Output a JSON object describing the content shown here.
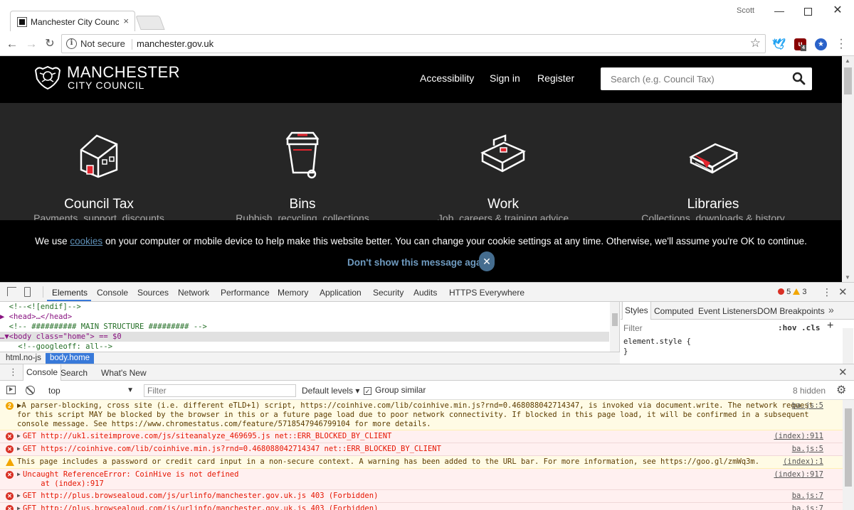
{
  "browser": {
    "tab_title": "Manchester City Council",
    "tab_close": "×",
    "user_name": "Scott",
    "window_buttons": {
      "minimize": "—",
      "maximize": "",
      "close": "✕"
    },
    "nav": {
      "back": "←",
      "forward": "→",
      "reload": "↻"
    },
    "security_label": "Not secure",
    "url": "manchester.gov.uk",
    "extensions": [
      "twitter-icon",
      "ublock-icon",
      "privacy-badger-icon"
    ],
    "extension_badge": "4"
  },
  "site": {
    "logo_line1": "MANCHESTER",
    "logo_line2": "CITY COUNCIL",
    "top_links": [
      "Accessibility",
      "Sign in",
      "Register"
    ],
    "search_placeholder": "Search (e.g. Council Tax)",
    "services": [
      {
        "title": "Council Tax",
        "subtitle": "Payments, support, discounts",
        "icon": "house-icon"
      },
      {
        "title": "Bins",
        "subtitle": "Rubbish, recycling, collections",
        "icon": "wheelie-bin-icon"
      },
      {
        "title": "Work",
        "subtitle": "Job, careers & training advice",
        "icon": "briefcase-icon"
      },
      {
        "title": "Libraries",
        "subtitle": "Collections, downloads & history",
        "icon": "book-icon"
      }
    ],
    "cookie": {
      "text_before": "We use ",
      "link": "cookies",
      "text_after": " on your computer or mobile device to help make this website better. You can change your cookie settings at any time. Otherwise, we'll assume you're OK to continue.",
      "dismiss": "Don't show this message again",
      "close": "✕"
    },
    "colors": {
      "header_bg": "#000000",
      "content_bg": "#262626",
      "accent_red": "#e3262f",
      "cookie_link": "#5e8fb6"
    }
  },
  "devtools": {
    "tabs": [
      "Elements",
      "Console",
      "Sources",
      "Network",
      "Performance",
      "Memory",
      "Application",
      "Security",
      "Audits",
      "HTTPS Everywhere"
    ],
    "active_tab": "Elements",
    "error_count": "5",
    "warning_count": "3",
    "elements": [
      {
        "text": "  <!--<![endif]-->",
        "kind": "comment"
      },
      {
        "text": "▶ <head>…</head>",
        "kind": "tag"
      },
      {
        "text": "  <!-- ########## MAIN STRUCTURE ######### -->",
        "kind": "comment"
      },
      {
        "text": "…▼<body class=\"home\"> == $0",
        "kind": "selected"
      },
      {
        "text": "    <!--googleoff: all-->",
        "kind": "comment"
      }
    ],
    "breadcrumbs": [
      "html.no-js",
      "body.home"
    ],
    "styles_tabs": [
      "Styles",
      "Computed",
      "Event Listeners",
      "DOM Breakpoints"
    ],
    "styles_more": "»",
    "styles_filter_placeholder": "Filter",
    "styles_hov": ":hov",
    "styles_cls": ".cls",
    "styles_add": "+",
    "styles_rule_open": "element.style {",
    "styles_rule_close": "}",
    "drawer_tabs": [
      "Console",
      "Search",
      "What's New"
    ],
    "console_context": "top",
    "console_filter_placeholder": "Filter",
    "console_levels": "Default levels ▾",
    "console_group_similar": "Group similar",
    "console_hidden": "8 hidden",
    "console_messages": [
      {
        "level": "warn",
        "badge": "2",
        "text": "▶A parser-blocking, cross site (i.e. different eTLD+1) script, https://coinhive.com/lib/coinhive.min.js?rnd=0.468088042714347, is invoked via document.write. The network request for this script MAY be blocked by the browser in this or a future page load due to poor network connectivity. If blocked in this page load, it will be confirmed in a subsequent console message. See https://www.chromestatus.com/feature/5718547946799104 for more details.",
        "source": "ba.js:5"
      },
      {
        "level": "error",
        "text": "GET http://uk1.siteimprove.com/js/siteanalyze_469695.js net::ERR_BLOCKED_BY_CLIENT",
        "source": "(index):911"
      },
      {
        "level": "error",
        "text": "GET https://coinhive.com/lib/coinhive.min.js?rnd=0.468088042714347 net::ERR_BLOCKED_BY_CLIENT",
        "source": "ba.js:5"
      },
      {
        "level": "violation",
        "text": "This page includes a password or credit card input in a non-secure context. A warning has been added to the URL bar. For more information, see https://goo.gl/zmWq3m.",
        "source": "(index):1"
      },
      {
        "level": "error",
        "text": "Uncaught ReferenceError: CoinHive is not defined\n    at (index):917",
        "source": "(index):917"
      },
      {
        "level": "error",
        "text": "GET http://plus.browsealoud.com/js/urlinfo/manchester.gov.uk.js 403 (Forbidden)",
        "source": "ba.js:7"
      },
      {
        "level": "error",
        "text": "GET http://plus.browsealoud.com/js/urlinfo/manchester.gov.uk.js 403 (Forbidden)",
        "source": "ba.js:7"
      }
    ]
  }
}
